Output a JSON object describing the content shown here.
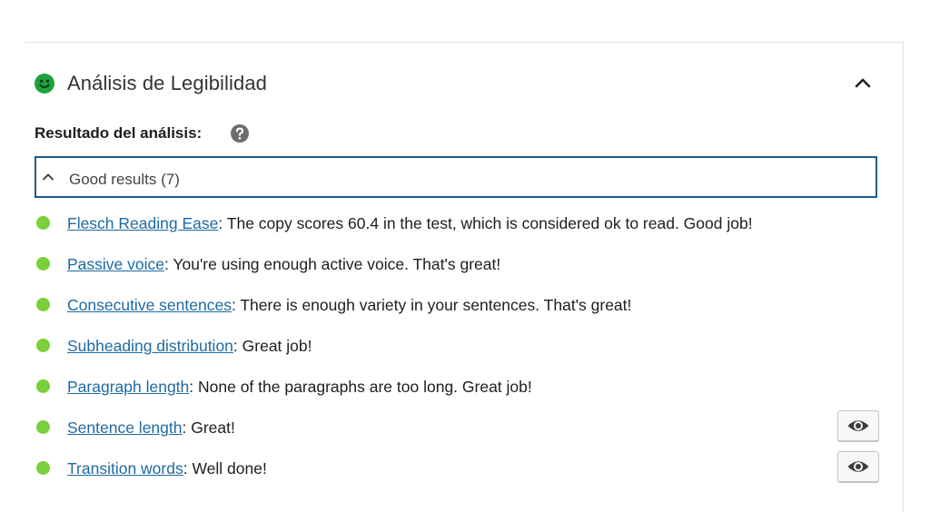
{
  "header": {
    "title": "Análisis de Legibilidad",
    "status_icon": "smiley-icon",
    "status_color": "#1fa13e"
  },
  "analysis": {
    "label": "Resultado del análisis:",
    "help_icon": "question-circle-icon"
  },
  "group": {
    "label": "Good results (7)"
  },
  "results": [
    {
      "link": "Flesch Reading Ease",
      "text": ": The copy scores 60.4 in the test, which is considered ok to read. Good job!",
      "has_eye": false
    },
    {
      "link": "Passive voice",
      "text": ": You're using enough active voice. That's great!",
      "has_eye": false
    },
    {
      "link": "Consecutive sentences",
      "text": ": There is enough variety in your sentences. That's great!",
      "has_eye": false
    },
    {
      "link": "Subheading distribution",
      "text": ": Great job!",
      "has_eye": false
    },
    {
      "link": "Paragraph length",
      "text": ": None of the paragraphs are too long. Great job!",
      "has_eye": false
    },
    {
      "link": "Sentence length",
      "text": ": Great!",
      "has_eye": true
    },
    {
      "link": "Transition words",
      "text": ": Well done!",
      "has_eye": true
    }
  ],
  "colors": {
    "good_dot": "#7ad03a",
    "link": "#1e6aa3",
    "focus_border": "#1f5b8a"
  }
}
